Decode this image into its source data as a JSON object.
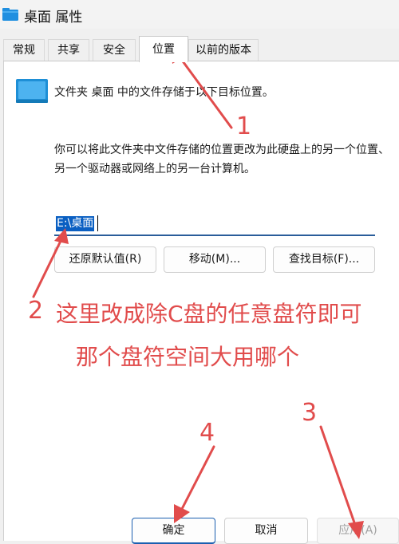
{
  "window": {
    "title": "桌面 属性",
    "icon": "folder-icon"
  },
  "tabs": [
    {
      "label": "常规",
      "active": false
    },
    {
      "label": "共享",
      "active": false
    },
    {
      "label": "安全",
      "active": false
    },
    {
      "label": "位置",
      "active": true
    },
    {
      "label": "以前的版本",
      "active": false
    }
  ],
  "location_tab": {
    "intro": "文件夹 桌面 中的文件存储于以下目标位置。",
    "description": "你可以将此文件夹中文件存储的位置更改为此硬盘上的另一个位置、另一个驱动器或网络上的另一台计算机。",
    "path_value": "E:\\桌面",
    "buttons": {
      "restore_default": "还原默认值(R)",
      "move": "移动(M)...",
      "find_target": "查找目标(F)..."
    }
  },
  "footer_buttons": {
    "ok": "确定",
    "cancel": "取消",
    "apply": "应用(A)"
  },
  "annotations": {
    "color": "#e14c4c",
    "n1": "1",
    "n2": "2",
    "note_line1": "这里改成除C盘的任意盘符即可",
    "note_line2": "那个盘符空间大用哪个",
    "n3": "3",
    "n4": "4"
  }
}
